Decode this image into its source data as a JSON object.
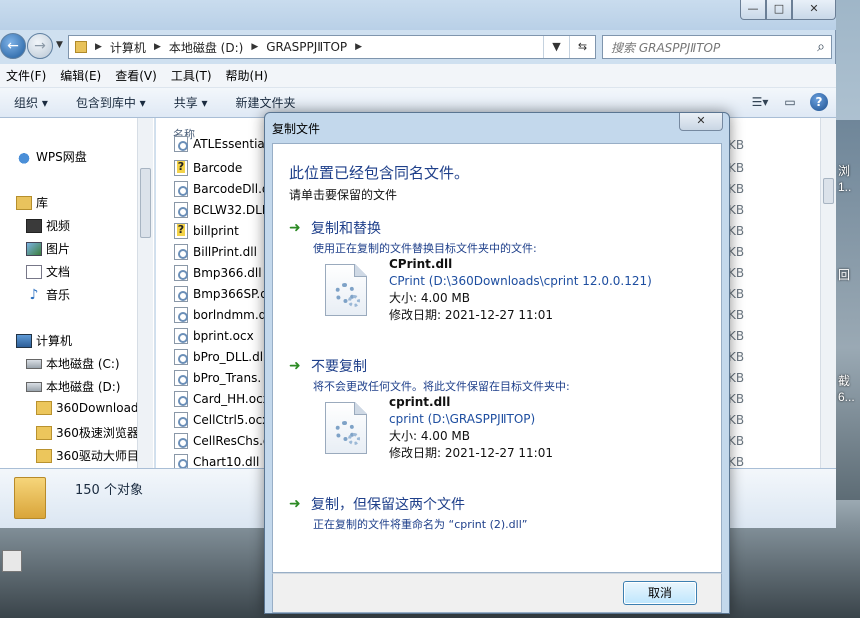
{
  "window": {
    "min_glyph": "—",
    "max_glyph": "□",
    "close_glyph": "✕"
  },
  "nav": {
    "back_glyph": "←",
    "forward_glyph": "→",
    "breadcrumbs": [
      "计算机",
      "本地磁盘 (D:)",
      "GRASPPJⅡTOP"
    ],
    "search_placeholder": "搜索 GRASPPJⅡTOP"
  },
  "menubar": [
    "文件(F)",
    "编辑(E)",
    "查看(V)",
    "工具(T)",
    "帮助(H)"
  ],
  "toolbar": {
    "organize": "组织 ▾",
    "include_library": "包含到库中 ▾",
    "share": "共享 ▾",
    "new_folder": "新建文件夹"
  },
  "sidebar": {
    "wps": "WPS网盘",
    "library": "库",
    "video": "视频",
    "pictures": "图片",
    "documents": "文档",
    "music": "音乐",
    "computer": "计算机",
    "drive_c": "本地磁盘 (C:)",
    "drive_d": "本地磁盘 (D:)",
    "folder1": "360Download",
    "folder2": "360极速浏览器",
    "folder3": "360驱动大师目"
  },
  "filelist": {
    "header": "名称",
    "files": [
      "ATLEssentia",
      "Barcode",
      "BarcodeDll.d",
      "BCLW32.DLL",
      "billprint",
      "BillPrint.dll",
      "Bmp366.dll",
      "Bmp366SP.d",
      "borlndmm.d",
      "bprint.ocx",
      "bPro_DLL.dl",
      "bPro_Trans.",
      "Card_HH.ocx",
      "CellCtrl5.ocx",
      "CellResChs.d",
      "Chart10.dll"
    ]
  },
  "right_pane_kb": [
    "KB",
    "KB",
    "KB",
    "KB",
    "KB",
    "KB",
    "KB",
    "KB",
    "KB",
    "KB",
    "KB",
    "KB",
    "KB",
    "KB",
    "KB",
    "KB"
  ],
  "details": {
    "count": "150 个对象"
  },
  "desktop_text": [
    "回",
    "截",
    "浏",
    "1..",
    "6..."
  ],
  "dialog": {
    "title": "复制文件",
    "heading": "此位置已经包含同名文件。",
    "subheading": "请单击要保留的文件",
    "option1": {
      "title": "复制和替换",
      "desc": "使用正在复制的文件替换目标文件夹中的文件:",
      "name": "CPrint.dll",
      "path": "CPrint (D:\\360Downloads\\cprint 12.0.0.121)",
      "size": "大小: 4.00 MB",
      "date": "修改日期: 2021-12-27 11:01"
    },
    "option2": {
      "title": "不要复制",
      "desc": "将不会更改任何文件。将此文件保留在目标文件夹中:",
      "name": "cprint.dll",
      "path": "cprint (D:\\GRASPPJⅡTOP)",
      "size": "大小: 4.00 MB",
      "date": "修改日期: 2021-12-27 11:01"
    },
    "option3": {
      "title": "复制，但保留这两个文件",
      "desc": "正在复制的文件将重命名为 “cprint (2).dll”"
    },
    "cancel": "取消"
  }
}
